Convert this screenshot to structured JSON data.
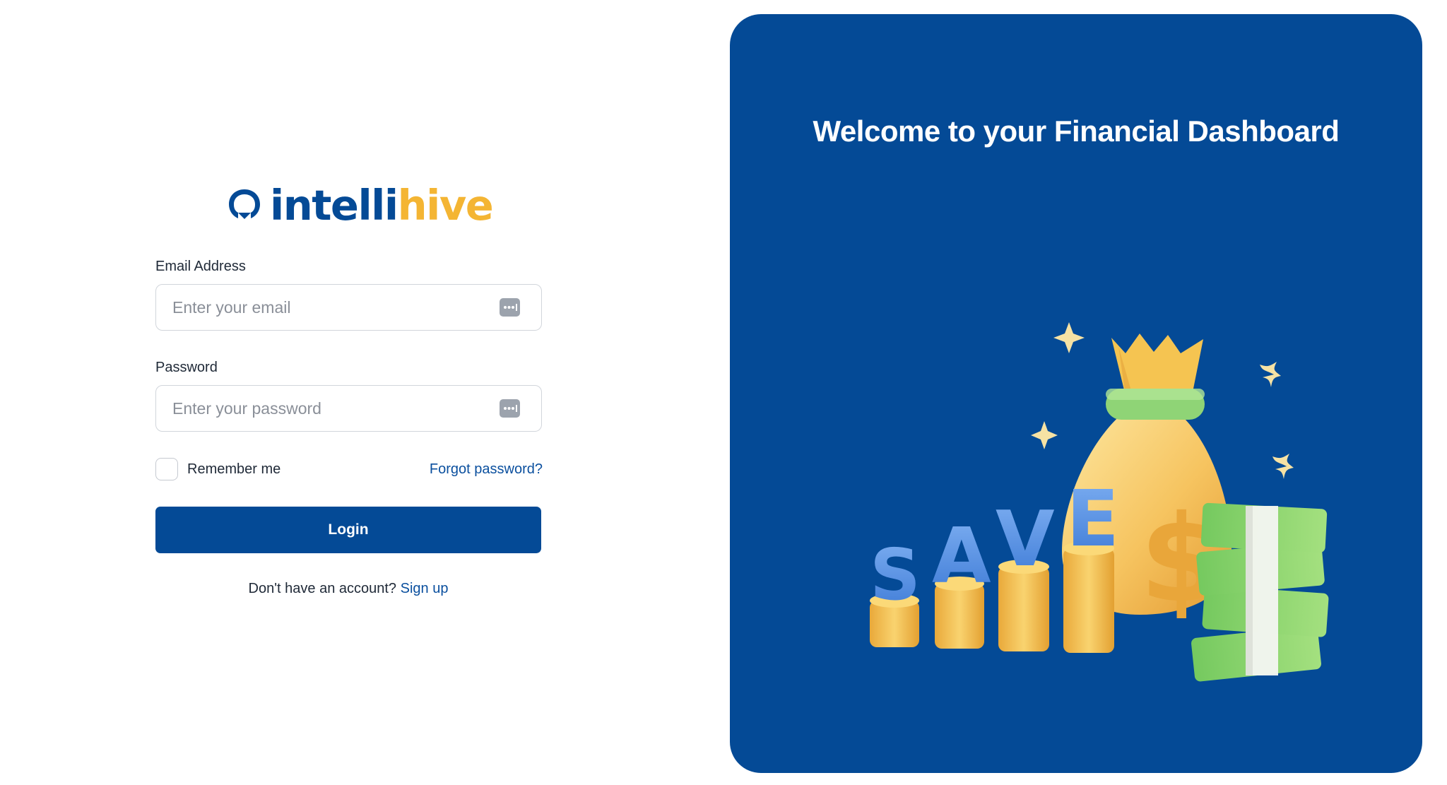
{
  "brand": {
    "name_part1": "intelli",
    "name_part2": "hive",
    "primary_color": "#044a96",
    "accent_color": "#f4b533"
  },
  "form": {
    "email": {
      "label": "Email Address",
      "placeholder": "Enter your email",
      "value": "",
      "icon": "password-manager-key-icon"
    },
    "password": {
      "label": "Password",
      "placeholder": "Enter your password",
      "value": "",
      "icon": "password-manager-key-icon"
    },
    "remember_label": "Remember me",
    "remember_checked": false,
    "forgot_label": "Forgot password?",
    "login_label": "Login",
    "signup_prompt": "Don't have an account?",
    "signup_label": "Sign up"
  },
  "hero": {
    "title": "Welcome to your Financial Dashboard",
    "background": "#044a96",
    "illustration": {
      "name": "savings-money-bag-illustration",
      "letters": [
        "S",
        "A",
        "V",
        "E",
        "$"
      ]
    }
  }
}
